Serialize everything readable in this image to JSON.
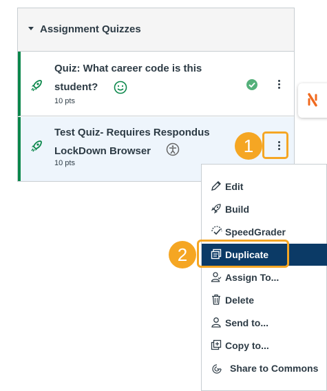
{
  "panel": {
    "title": "Assignment Quizzes",
    "accent_color": "#0b874b",
    "icons": {
      "collapse": "caret-down-icon",
      "quiz": "rocket-icon"
    }
  },
  "quizzes": [
    {
      "title": "Quiz: What career code is this student?",
      "points": "10 pts",
      "title_icon": "smiley-icon",
      "status_icon": "published-check-icon"
    },
    {
      "title": "Test Quiz- Requires Respondus LockDown Browser",
      "points": "10 pts",
      "title_icon": "accessibility-icon"
    }
  ],
  "callouts": {
    "step1": "1",
    "step2": "2",
    "color": "#f5a623"
  },
  "menu": {
    "active_color": "#0b3a66",
    "items": [
      {
        "label": "Edit",
        "icon": "pencil-icon"
      },
      {
        "label": "Build",
        "icon": "rocket-icon"
      },
      {
        "label": "SpeedGrader",
        "icon": "speedgrader-icon"
      },
      {
        "label": "Duplicate",
        "icon": "duplicate-icon",
        "active": true
      },
      {
        "label": "Assign To...",
        "icon": "assign-user-icon"
      },
      {
        "label": "Delete",
        "icon": "trash-icon"
      },
      {
        "label": "Send to...",
        "icon": "user-icon"
      },
      {
        "label": "Copy to...",
        "icon": "copy-icon"
      },
      {
        "label": "Share to Commons",
        "icon": "commons-icon"
      }
    ]
  },
  "extension": {
    "icon": "extension-logo-icon",
    "color": "#f06a1f"
  }
}
